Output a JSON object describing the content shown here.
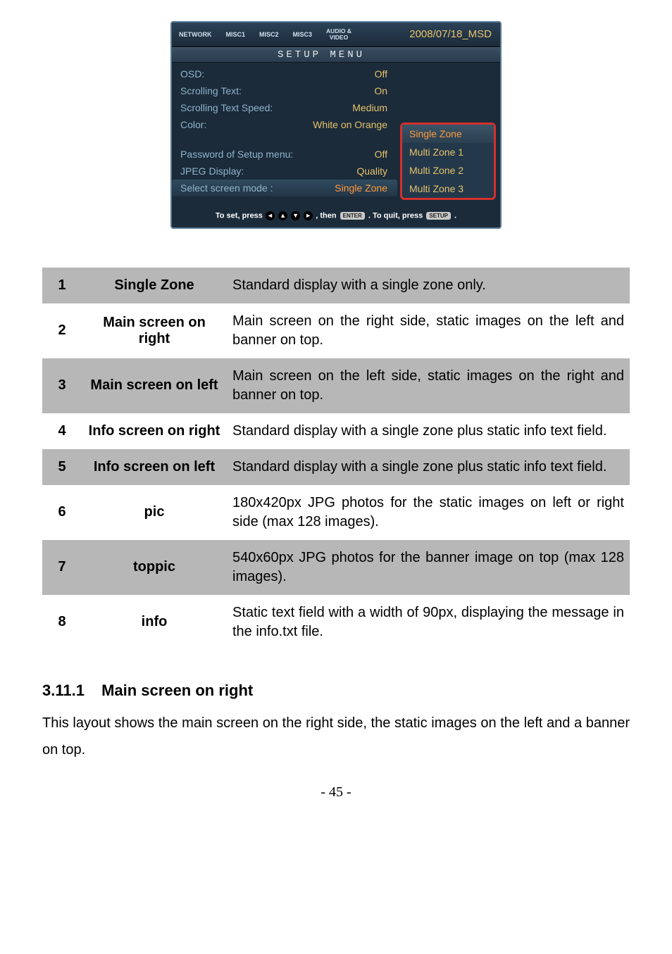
{
  "setup": {
    "tabs": [
      "NETWORK",
      "MISC1",
      "MISC2",
      "MISC3",
      "AUDIO &\nVIDEO"
    ],
    "date": "2008/07/18_MSD",
    "title": "SETUP MENU",
    "rows": [
      {
        "label": "OSD:",
        "value": "Off"
      },
      {
        "label": "Scrolling Text:",
        "value": "On"
      },
      {
        "label": "Scrolling Text Speed:",
        "value": "Medium"
      },
      {
        "label": "Color:",
        "value": "White on Orange"
      }
    ],
    "rows2": [
      {
        "label": "Password of Setup menu:",
        "value": "Off"
      },
      {
        "label": "JPEG Display:",
        "value": "Quality"
      },
      {
        "label": "Select screen mode :",
        "value": "Single Zone",
        "selected": true
      }
    ],
    "popup": [
      "Single Zone",
      "Multi Zone 1",
      "Multi Zone 2",
      "Multi Zone 3"
    ],
    "popup_selected": 0,
    "footer_a": "To set, press",
    "footer_b": ", then",
    "footer_c": ". To quit, press",
    "footer_d": ".",
    "badge_enter": "ENTER",
    "badge_setup": "SETUP"
  },
  "table": [
    {
      "n": "1",
      "name": "Single Zone",
      "desc": "Standard display with a single zone only.",
      "shade": true
    },
    {
      "n": "2",
      "name": "Main screen on right",
      "desc": "Main screen on the right side, static images on the left and banner on top."
    },
    {
      "n": "3",
      "name": "Main screen on left",
      "desc": "Main screen on the left side, static images on the right and banner on top.",
      "shade": true
    },
    {
      "n": "4",
      "name": "Info screen on right",
      "desc": "Standard display with a single zone plus static info text field."
    },
    {
      "n": "5",
      "name": "Info screen on left",
      "desc": "Standard display with a single zone plus static info text field.",
      "shade": true
    },
    {
      "n": "6",
      "name": "pic",
      "desc": "180x420px JPG photos for the static images on left or right side (max 128 images)."
    },
    {
      "n": "7",
      "name": "toppic",
      "desc": "540x60px JPG photos for the banner image on top (max 128 images).",
      "shade": true
    },
    {
      "n": "8",
      "name": "info",
      "desc": "Static text field with a width of 90px, displaying the message in the info.txt file."
    }
  ],
  "section": {
    "num": "3.11.1",
    "title": "Main screen on right"
  },
  "body": "This layout shows the main screen on the right side, the static images on the left and a banner on top.",
  "pagenum": "- 45 -"
}
